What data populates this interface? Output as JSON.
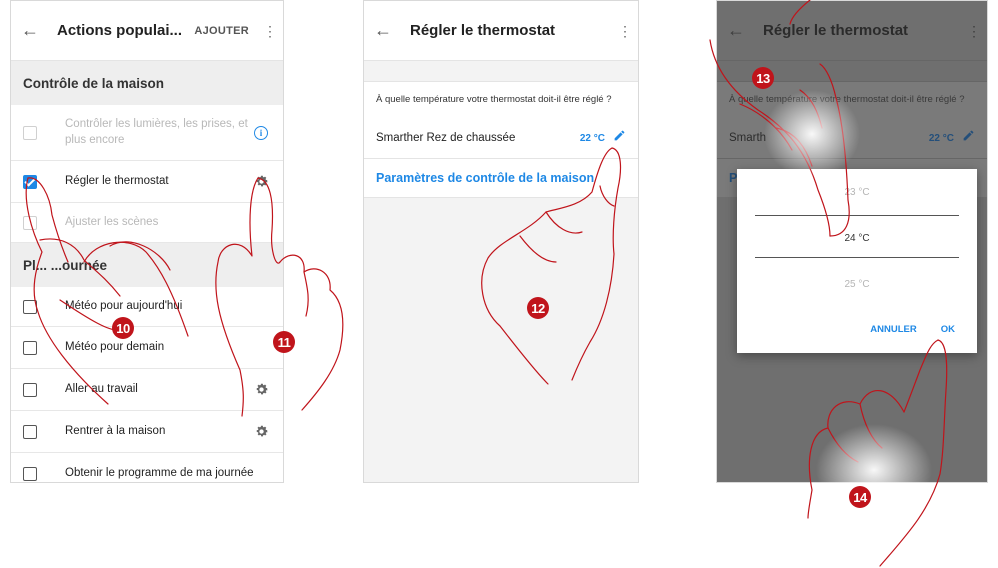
{
  "screen1": {
    "back_icon": "arrow-left-icon",
    "title": "Actions populai...",
    "add_label": "AJOUTER",
    "menu_icon": "more-vert-icon",
    "section1_header": "Contrôle de la maison",
    "section1_items": [
      {
        "label": "Contrôler les lumières, les prises, et plus encore",
        "checked": false,
        "disabled": true,
        "icon": "info-icon"
      },
      {
        "label": "Régler le thermostat",
        "checked": true,
        "disabled": false,
        "icon": "gear-icon"
      },
      {
        "label": "Ajuster les scènes",
        "checked": false,
        "disabled": true,
        "icon": ""
      }
    ],
    "section2_header": "Pl... ...ournée",
    "section2_items": [
      {
        "label": "Météo pour aujourd'hui",
        "icon": ""
      },
      {
        "label": "Météo pour demain",
        "icon": ""
      },
      {
        "label": "Aller au travail",
        "icon": "gear-icon"
      },
      {
        "label": "Rentrer à la maison",
        "icon": "gear-icon"
      },
      {
        "label": "Obtenir le programme de ma journée",
        "icon": ""
      }
    ]
  },
  "screen2": {
    "back_icon": "arrow-left-icon",
    "title": "Régler le thermostat",
    "menu_icon": "more-vert-icon",
    "question": "À quelle température votre thermostat doit-il être réglé ?",
    "device_name": "Smarther Rez de chaussée",
    "device_temp": "22 °C",
    "edit_icon": "pencil-icon",
    "settings_link": "Paramètres de contrôle de la maison"
  },
  "screen3": {
    "title": "Régler le thermostat",
    "question": "À quelle température votre thermostat doit-il être réglé ?",
    "device_name": "Smarth",
    "device_temp": "22 °C",
    "link_fragment": "P",
    "picker_values": [
      "23 °C",
      "24 °C",
      "25 °C"
    ],
    "cancel_label": "ANNULER",
    "ok_label": "OK"
  },
  "steps": [
    "10",
    "11",
    "12",
    "13",
    "14"
  ],
  "colors": {
    "accent": "#1e88e5",
    "badge": "#c0141b",
    "hand_stroke": "#c0141b",
    "dim_overlay": "#6f6f6f"
  }
}
